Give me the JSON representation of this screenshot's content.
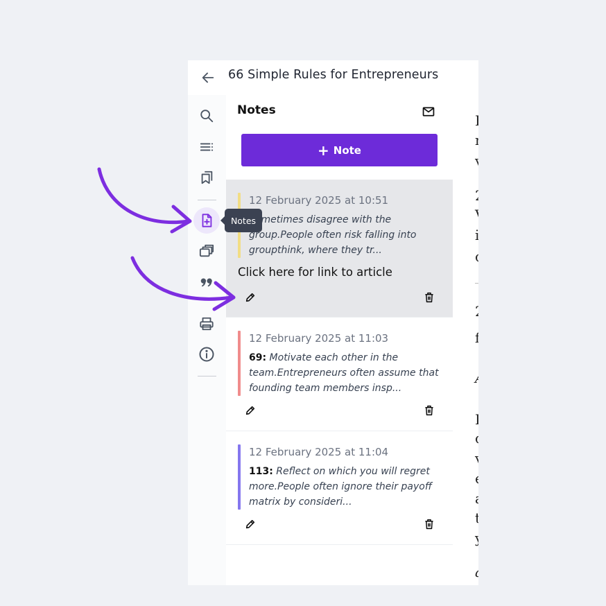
{
  "window": {
    "book_title": "66 Simple Rules for Entrepreneurs"
  },
  "icons": {
    "back": "arrow-left-icon",
    "rail": [
      "search-icon",
      "contents-icon",
      "bookmarks-icon",
      "add-note-icon",
      "flashcards-icon",
      "quote-icon",
      "print-icon",
      "info-icon"
    ],
    "mail": "envelope-icon",
    "edit": "pencil-icon",
    "delete": "trash-icon"
  },
  "tooltip": {
    "label": "Notes"
  },
  "notes_panel": {
    "title": "Notes",
    "add_button_label": "Note",
    "items": [
      {
        "date": "12 February 2025 at 10:51",
        "number": "",
        "excerpt": "Sometimes disagree with the group.People often risk falling into groupthink, where they tr...",
        "link_text": "Click here for link to article",
        "accent": "#f2dd85"
      },
      {
        "date": "12 February 2025 at 11:03",
        "number": "69:",
        "excerpt": "Motivate each other in the team.Entrepreneurs often assume that founding team members insp...",
        "link_text": "",
        "accent": "#f08c8c"
      },
      {
        "date": "12 February 2025 at 11:04",
        "number": "113:",
        "excerpt": "Reflect on which you will regret more.People often ignore their payoff matrix by consideri...",
        "link_text": "",
        "accent": "#8577ee"
      }
    ]
  },
  "reader": {
    "fragments": [
      "F",
      "n",
      "v",
      "2",
      "V",
      "i",
      "c",
      "2",
      "f",
      "A",
      "I",
      "c",
      "v",
      "e",
      "a",
      "t",
      "y",
      "a"
    ]
  },
  "colors": {
    "accent_purple": "#6d2bd9",
    "annotation_arrow": "#7d2ee0"
  }
}
